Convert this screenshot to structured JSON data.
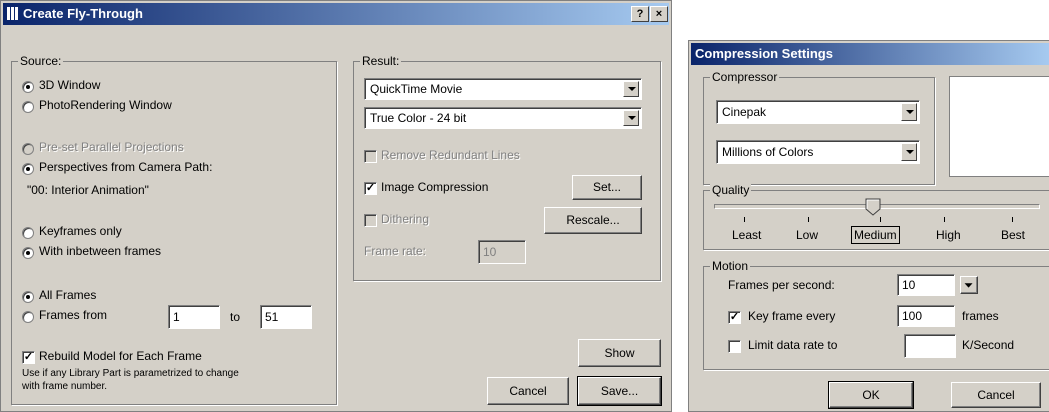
{
  "fly": {
    "title": "Create Fly-Through",
    "help_btn": "?",
    "close_btn": "×",
    "source": {
      "legend": "Source:",
      "window_3d": "3D Window",
      "photo_window": "PhotoRendering Window",
      "parallel": "Pre-set Parallel Projections",
      "perspectives": "Perspectives from Camera Path:",
      "path_name": "\"00: Interior Animation\"",
      "keyframes_only": "Keyframes only",
      "inbetween": "With inbetween frames",
      "all_frames": "All Frames",
      "frames_from": "Frames from",
      "from_value": "1",
      "to_label": "to",
      "to_value": "51",
      "rebuild": "Rebuild Model for Each Frame",
      "hint_line1": "Use if any Library Part is parametrized to change",
      "hint_line2": "with frame number."
    },
    "result": {
      "legend": "Result:",
      "format": "QuickTime Movie",
      "color": "True Color - 24 bit",
      "remove_lines": "Remove Redundant Lines",
      "image_compression": "Image Compression",
      "set_btn": "Set...",
      "dithering": "Dithering",
      "rescale_btn": "Rescale...",
      "frame_rate_label": "Frame rate:",
      "frame_rate_value": "10"
    },
    "show_btn": "Show",
    "cancel_btn": "Cancel",
    "save_btn": "Save..."
  },
  "comp": {
    "title": "Compression Settings",
    "compressor_legend": "Compressor",
    "codec": "Cinepak",
    "depth": "Millions of Colors",
    "quality_legend": "Quality",
    "quality_labels": [
      "Least",
      "Low",
      "Medium",
      "High",
      "Best"
    ],
    "quality_level": "Medium",
    "motion_legend": "Motion",
    "fps_label": "Frames per second:",
    "fps_value": "10",
    "key_frame_label": "Key frame every",
    "key_frame_value": "100",
    "frames_unit": "frames",
    "limit_label": "Limit data rate to",
    "limit_value": "",
    "kps_unit": "K/Second",
    "ok_btn": "OK",
    "cancel_btn": "Cancel"
  },
  "colors": {
    "title_start": "#0a246a",
    "title_end": "#a6caf0",
    "face": "#d4d0c8"
  }
}
